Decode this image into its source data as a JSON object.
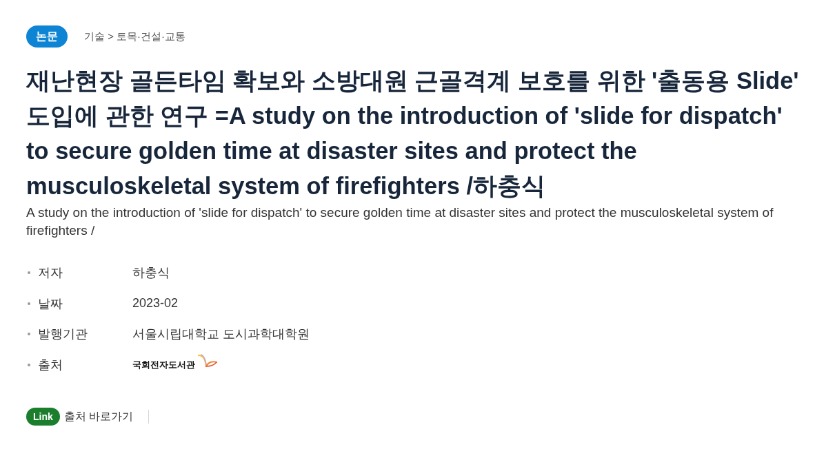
{
  "category_badge": "논문",
  "breadcrumb": "기술 > 토목·건설·교통",
  "title": "재난현장 골든타임 확보와 소방대원 근골격계 보호를 위한 '출동용 Slide' 도입에 관한 연구 =A study on the introduction of 'slide for dispatch' to secure golden time at disaster sites and protect the musculoskeletal system of firefighters /하충식",
  "subtitle": "A study on the introduction of 'slide for dispatch' to secure golden time at disaster sites and protect the musculoskeletal system of firefighters /",
  "details": [
    {
      "label": "저자",
      "value": "하충식",
      "kind": "text"
    },
    {
      "label": "날짜",
      "value": "2023-02",
      "kind": "text"
    },
    {
      "label": "발행기관",
      "value": "서울시립대학교 도시과학대학원",
      "kind": "text"
    },
    {
      "label": "출처",
      "value": "국회전자도서관",
      "kind": "logo"
    }
  ],
  "link": {
    "badge": "Link",
    "label": "출처 바로가기"
  }
}
